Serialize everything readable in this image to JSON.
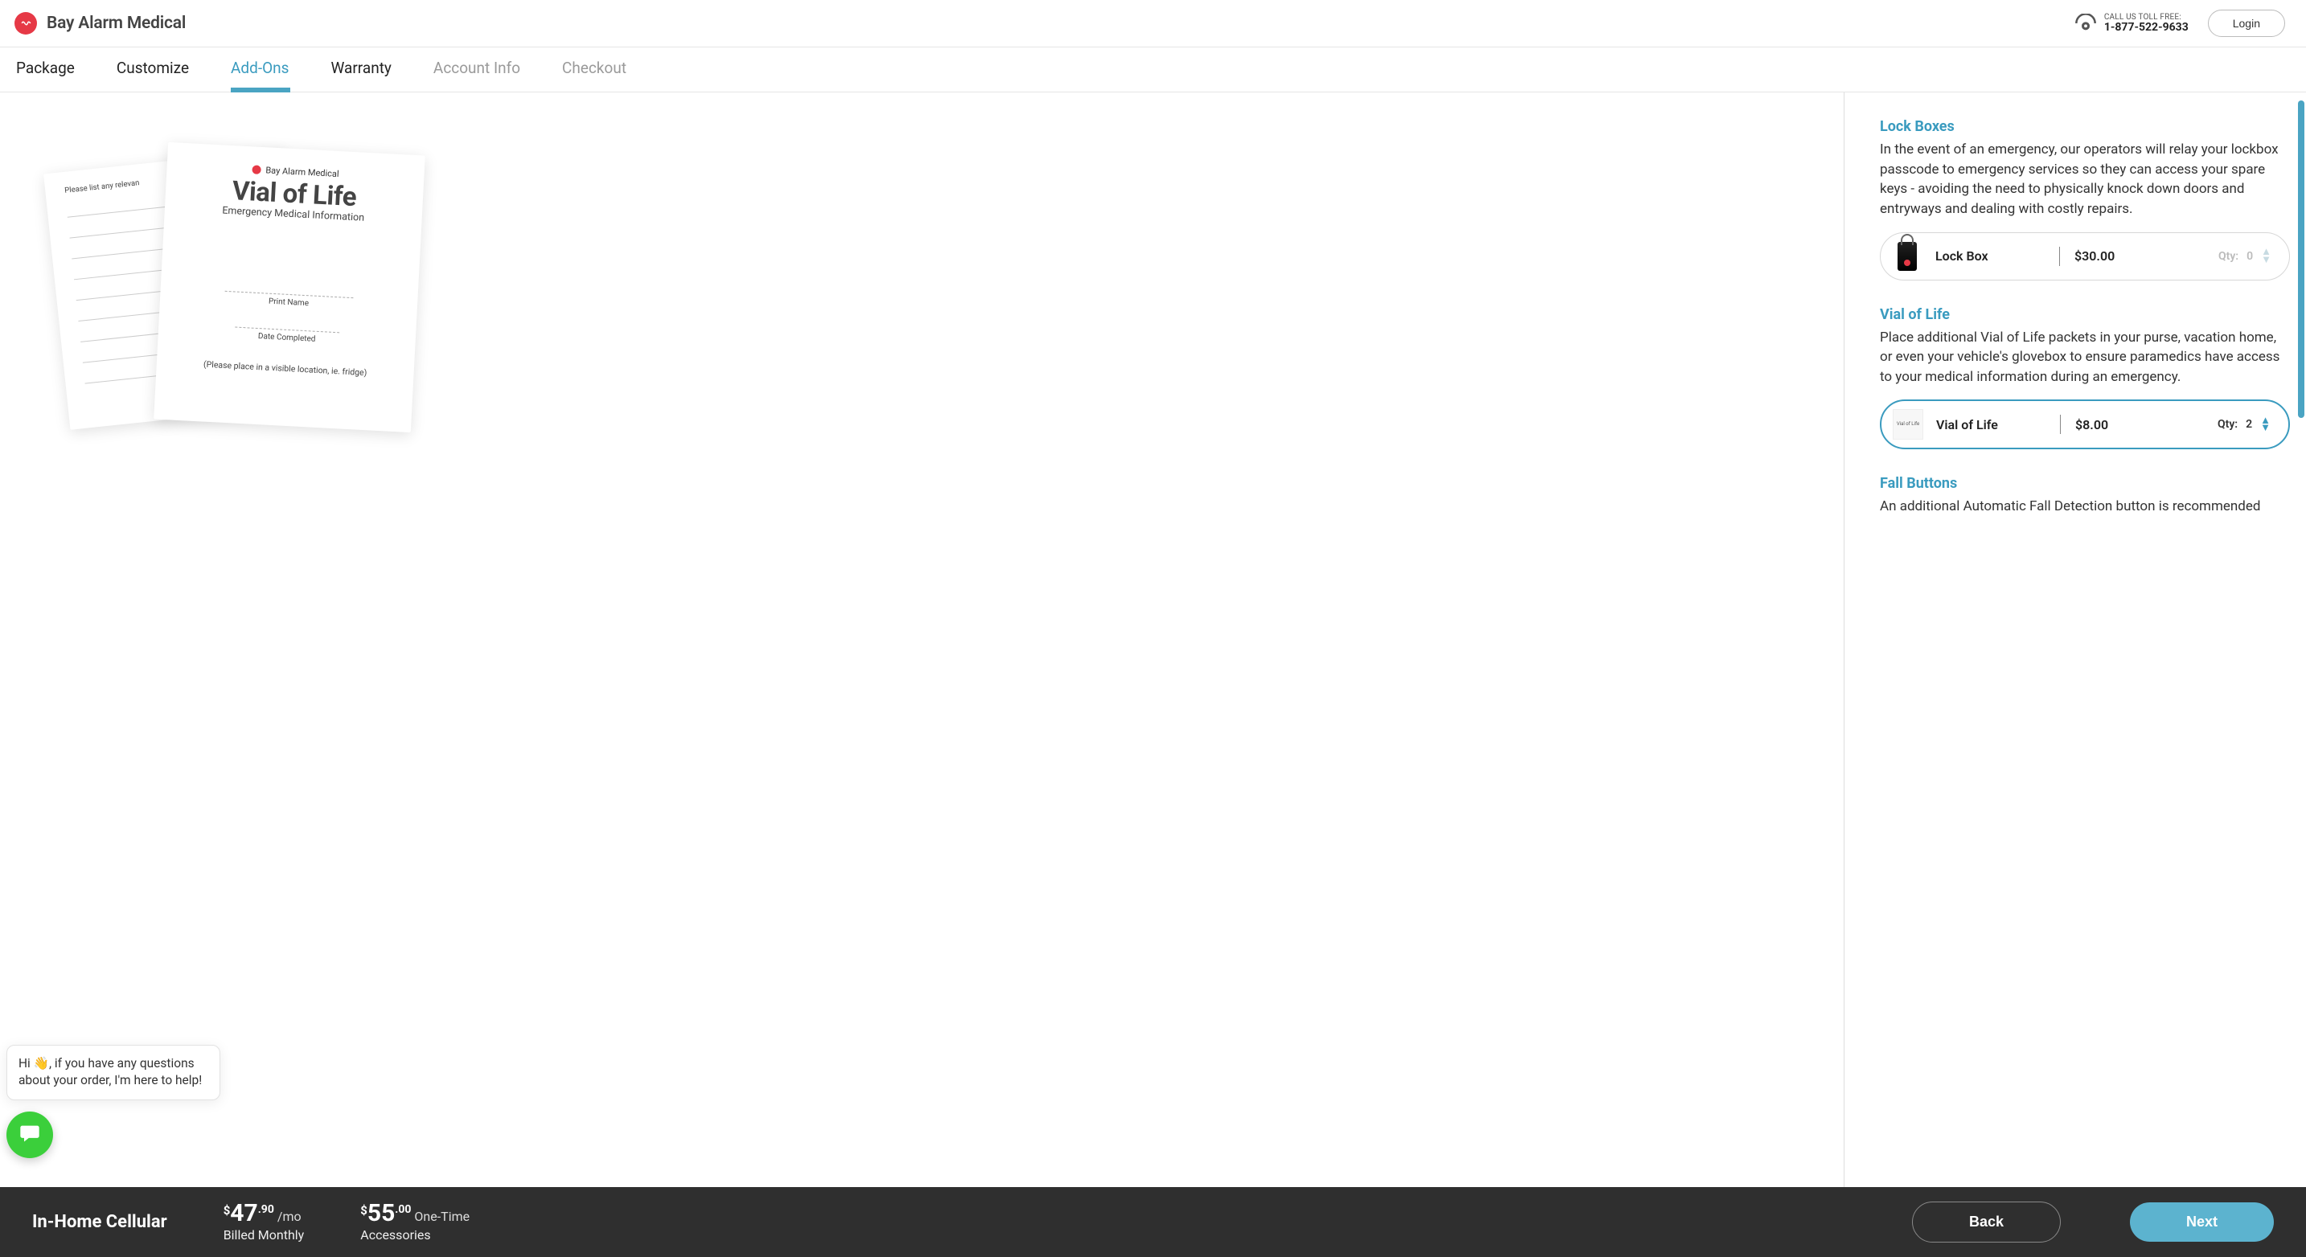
{
  "header": {
    "brand_name": "Bay Alarm Medical",
    "toll_label": "CALL US TOLL FREE:",
    "toll_number": "1-877-522-9633",
    "login_label": "Login"
  },
  "steps": {
    "items": [
      {
        "label": "Package",
        "state": "done"
      },
      {
        "label": "Customize",
        "state": "done"
      },
      {
        "label": "Add-Ons",
        "state": "active"
      },
      {
        "label": "Warranty",
        "state": "done"
      },
      {
        "label": "Account Info",
        "state": "disabled"
      },
      {
        "label": "Checkout",
        "state": "disabled"
      }
    ]
  },
  "paper": {
    "back_heading": "Please list any relevan",
    "brand_small": "Bay Alarm Medical",
    "title": "Vial of Life",
    "subtitle": "Emergency Medical Information",
    "print_name": "Print Name",
    "date_completed": "Date Completed",
    "note": "(Please place in a visible location, ie. fridge)"
  },
  "sections": {
    "lockboxes": {
      "title": "Lock Boxes",
      "desc": "In the event of an emergency, our operators will relay your lockbox passcode to emergency services so they can access your spare keys - avoiding the need to physically knock down doors and entryways and dealing with costly repairs.",
      "item_name": "Lock Box",
      "item_price": "$30.00",
      "qty_label": "Qty:",
      "qty_value": "0"
    },
    "vial": {
      "title": "Vial of Life",
      "desc": "Place additional Vial of Life packets in your purse, vacation home, or even your vehicle's glovebox to ensure paramedics have access to your medical information during an emergency.",
      "item_name": "Vial of Life",
      "item_price": "$8.00",
      "qty_label": "Qty:",
      "qty_value": "2",
      "thumb_text": "Vial of Life"
    },
    "fall": {
      "title": "Fall Buttons",
      "desc": "An additional Automatic Fall Detection button is recommended"
    }
  },
  "chat": {
    "message": "Hi 👋, if you have any questions about your order, I'm here to help!"
  },
  "footer": {
    "plan_name": "In-Home Cellular",
    "monthly": {
      "currency": "$",
      "dollars": "47",
      "cents": ".90",
      "per": "/mo",
      "sub": "Billed Monthly"
    },
    "onetime": {
      "currency": "$",
      "dollars": "55",
      "cents": ".00",
      "per": "One-Time",
      "sub": "Accessories"
    },
    "back_label": "Back",
    "next_label": "Next"
  }
}
